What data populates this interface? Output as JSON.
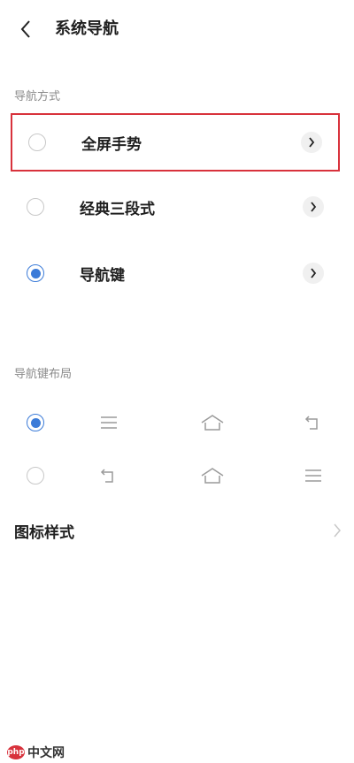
{
  "header": {
    "title": "系统导航",
    "back_icon": "chevron-left-icon"
  },
  "nav_mode": {
    "section_label": "导航方式",
    "options": [
      {
        "label": "全屏手势",
        "selected": false,
        "highlighted": true
      },
      {
        "label": "经典三段式",
        "selected": false
      },
      {
        "label": "导航键",
        "selected": true
      }
    ]
  },
  "key_layout": {
    "section_label": "导航键布局",
    "rows": [
      {
        "selected": true,
        "icons": [
          "menu-lines-icon",
          "home-icon",
          "back-return-icon"
        ]
      },
      {
        "selected": false,
        "icons": [
          "back-return-icon",
          "home-icon",
          "menu-lines-icon"
        ]
      }
    ]
  },
  "icon_style": {
    "label": "图标样式"
  },
  "watermark": {
    "logo": "php",
    "text": "中文网"
  },
  "colors": {
    "accent": "#3b7bd8",
    "highlight_border": "#d8323c",
    "text": "#1f1f1f",
    "label_gray": "#8a8a8a"
  }
}
